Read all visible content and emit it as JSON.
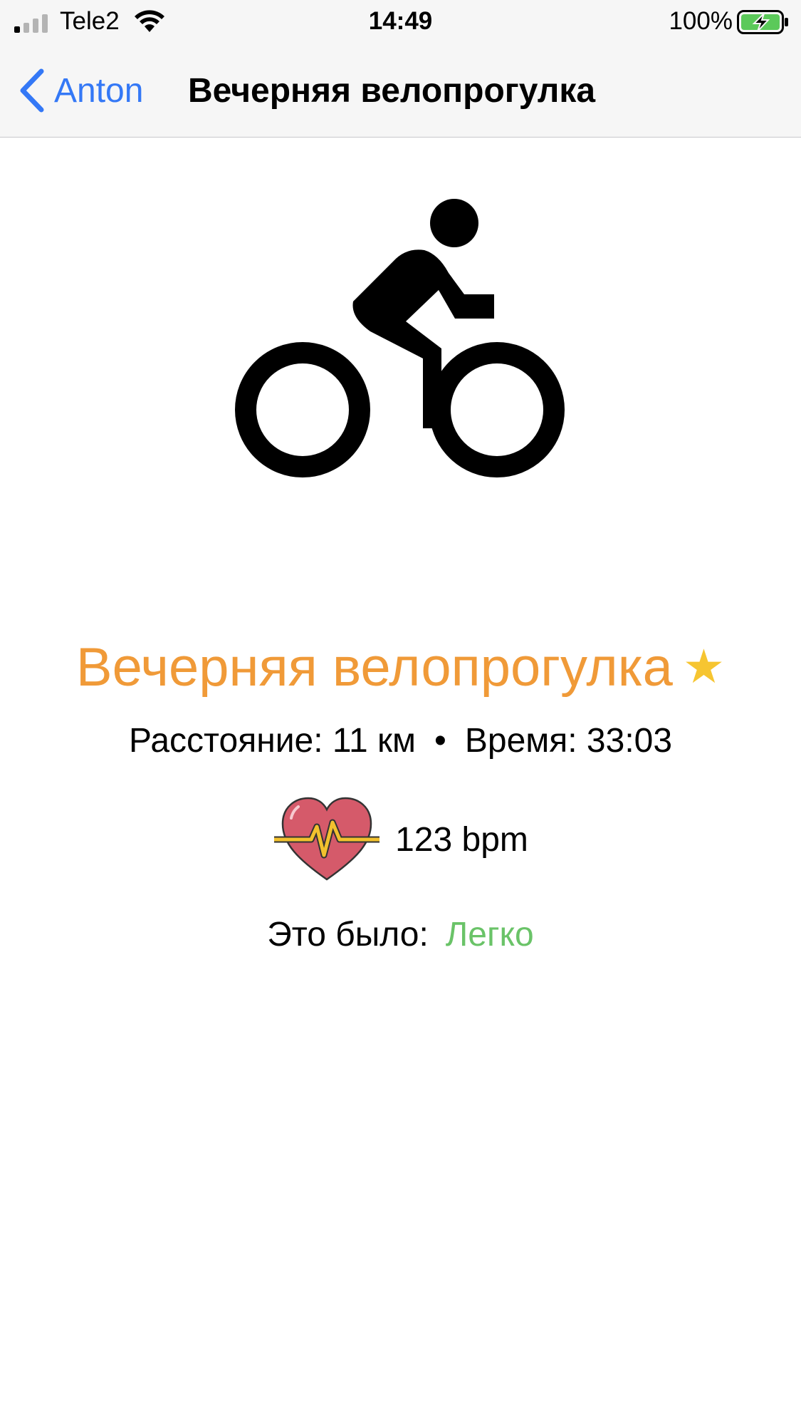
{
  "status_bar": {
    "carrier": "Tele2",
    "time": "14:49",
    "battery_percent": "100%",
    "signal_bars_filled": 1,
    "signal_bars_total": 4,
    "battery_level": 1.0,
    "battery_charging": true
  },
  "nav": {
    "back_label": "Anton",
    "title": "Вечерняя велопрогулка"
  },
  "activity": {
    "icon": "bicycle-icon",
    "title": "Вечерняя велопрогулка",
    "favorite_icon": "star-icon",
    "star_glyph": "★",
    "distance_text": "Расстояние: 11 км",
    "separator": "•",
    "time_text": "Время: 33:03",
    "heart_icon": "heart-rate-icon",
    "bpm_text": "123 bpm",
    "effort_label": "Это было:",
    "effort_value": "Легко"
  },
  "colors": {
    "accent_blue": "#3478f6",
    "title_orange": "#f09a38",
    "star_yellow": "#f6c531",
    "effort_green": "#6ac368",
    "heart_red": "#d55a6a",
    "pulse_yellow": "#f2c12e",
    "battery_green": "#5bc95a"
  }
}
